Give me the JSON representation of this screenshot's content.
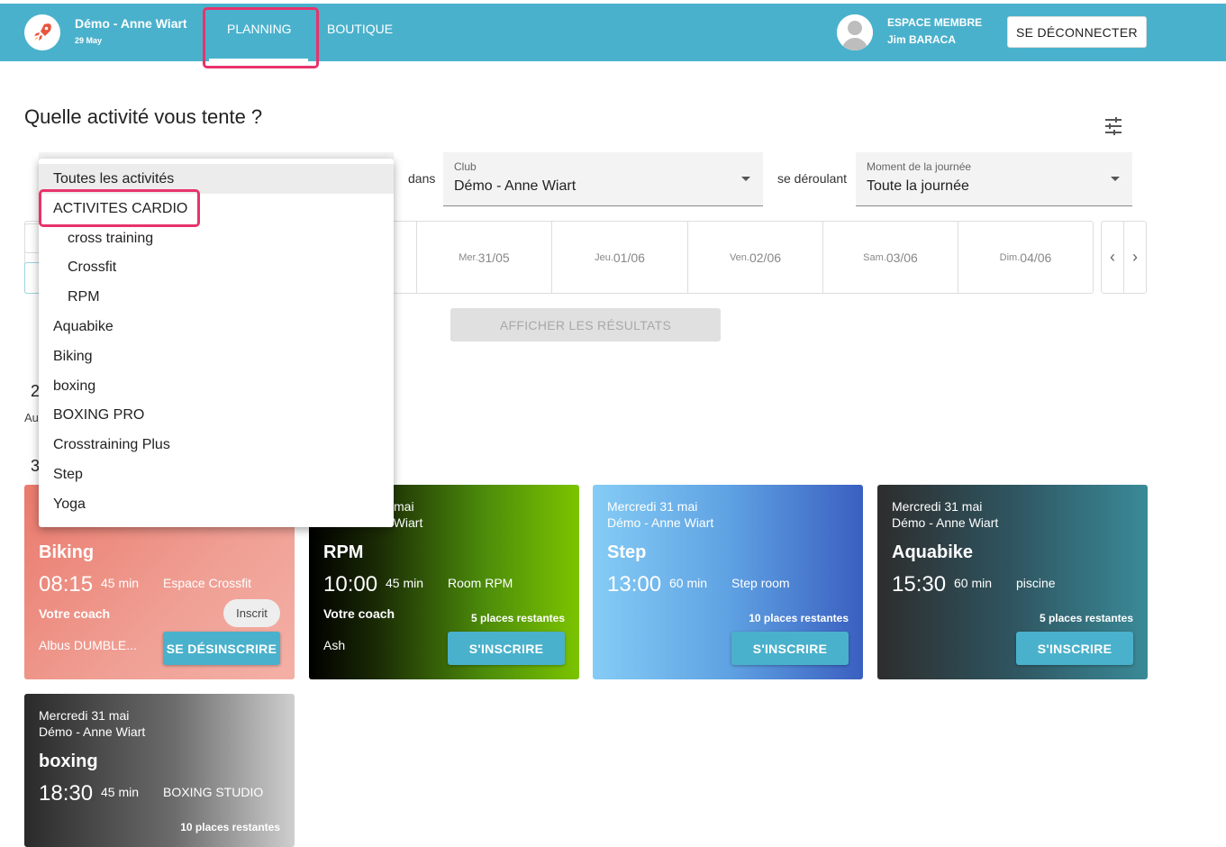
{
  "header": {
    "club_name": "Démo - Anne Wiart",
    "date": "29 May",
    "nav": {
      "planning": "PLANNING",
      "boutique": "BOUTIQUE"
    },
    "member_label": "ESPACE MEMBRE",
    "member_name": "Jim BARACA",
    "logout": "SE DÉCONNECTER",
    "brand_color": "#4ab1cc",
    "highlight_color": "#e8336b"
  },
  "search": {
    "question": "Quelle activité vous tente ?",
    "filter_icon": "tune-icon",
    "dans": "dans",
    "club_label": "Club",
    "club_value": "Démo - Anne Wiart",
    "se_deroulant": "se déroulant",
    "moment_label": "Moment de la journée",
    "moment_value": "Toute la journée",
    "results_button": "AFFICHER LES RÉSULTATS"
  },
  "days": [
    {
      "name": "Mer.",
      "num": "31/05"
    },
    {
      "name": "Jeu.",
      "num": "01/06"
    },
    {
      "name": "Ven.",
      "num": "02/06"
    },
    {
      "name": "Sam.",
      "num": "03/06"
    },
    {
      "name": "Dim.",
      "num": "04/06"
    }
  ],
  "behind": {
    "count1": "2",
    "text1": "Au",
    "count2": "3"
  },
  "dropdown": {
    "items": [
      "Toutes les activités",
      "ACTIVITES CARDIO",
      "cross training",
      "Crossfit",
      "RPM",
      "Aquabike",
      "Biking",
      "boxing",
      "BOXING PRO",
      "Crosstraining Plus",
      "Step",
      "Yoga"
    ]
  },
  "cards": [
    {
      "date": "",
      "club": "",
      "activity": "Biking",
      "time": "08:15",
      "duration": "45 min",
      "room": "Espace Crossfit",
      "coach_label": "Votre coach",
      "coach": "Albus DUMBLE...",
      "badge": "Inscrit",
      "places": "",
      "button": "SE DÉSINSCRIRE"
    },
    {
      "date": "mai",
      "club": "e Wiart",
      "activity": "RPM",
      "time": "10:00",
      "duration": "45 min",
      "room": "Room RPM",
      "coach_label": "Votre coach",
      "coach": "Ash",
      "places": "5 places restantes",
      "button": "S'INSCRIRE"
    },
    {
      "date": "Mercredi 31 mai",
      "club": "Démo - Anne Wiart",
      "activity": "Step",
      "time": "13:00",
      "duration": "60 min",
      "room": "Step room",
      "places": "10 places restantes",
      "button": "S'INSCRIRE"
    },
    {
      "date": "Mercredi 31 mai",
      "club": "Démo - Anne Wiart",
      "activity": "Aquabike",
      "time": "15:30",
      "duration": "60 min",
      "room": "piscine",
      "places": "5 places restantes",
      "button": "S'INSCRIRE"
    },
    {
      "date": "Mercredi 31 mai",
      "club": "Démo - Anne Wiart",
      "activity": "boxing",
      "time": "18:30",
      "duration": "45 min",
      "room": "BOXING STUDIO",
      "places": "10 places restantes"
    }
  ]
}
